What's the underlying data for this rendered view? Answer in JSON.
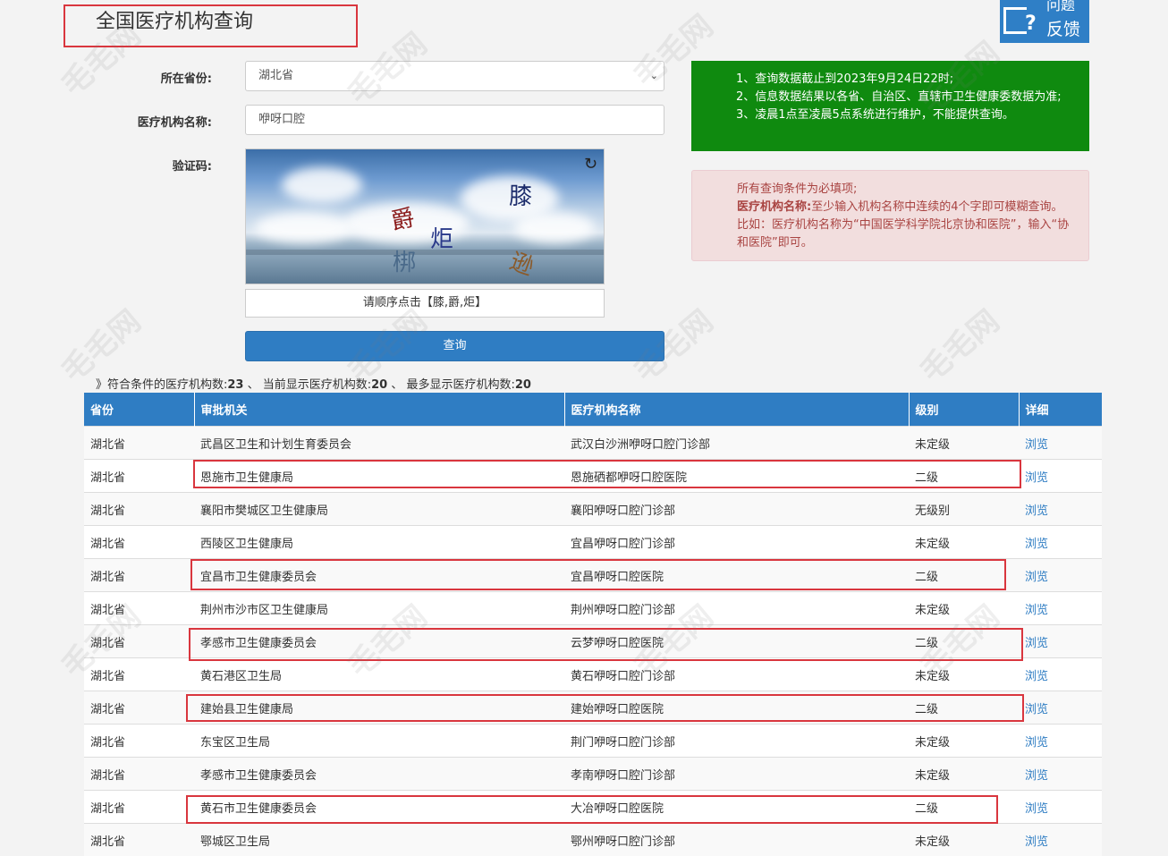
{
  "title": "全国医疗机构查询",
  "feedback": {
    "top": "问题",
    "label": "反馈"
  },
  "form": {
    "province_label": "所在省份:",
    "province_value": "湖北省",
    "name_label": "医疗机构名称:",
    "name_value": "咿呀口腔",
    "captcha_label": "验证码:",
    "captcha_chars": [
      "膝",
      "爵",
      "炬",
      "梆",
      "逊"
    ],
    "captcha_hint": "请顺序点击【膝,爵,炬】",
    "query_button": "查询"
  },
  "notice_green": [
    "1、查询数据截止到2023年9月24日22时;",
    "2、信息数据结果以各省、自治区、直辖市卫生健康委数据为准;",
    "3、凌晨1点至凌晨5点系统进行维护，不能提供查询。"
  ],
  "notice_red": {
    "line1": "所有查询条件为必填项;",
    "bold": "医疗机构名称:",
    "rest": "至少输入机构名称中连续的4个字即可模糊查询。比如：医疗机构名称为“中国医学科学院北京协和医院”，输入“协和医院”即可。"
  },
  "summary": {
    "prefix": "》符合条件的医疗机构数:",
    "total": "23",
    "sep1": "、 当前显示医疗机构数:",
    "shown": "20",
    "sep2": "、 最多显示医疗机构数:",
    "max": "20"
  },
  "table": {
    "headers": [
      "省份",
      "审批机关",
      "医疗机构名称",
      "级别",
      "详细"
    ],
    "rows": [
      [
        "湖北省",
        "武昌区卫生和计划生育委员会",
        "武汉白沙洲咿呀口腔门诊部",
        "未定级",
        "浏览"
      ],
      [
        "湖北省",
        "恩施市卫生健康局",
        "恩施硒都咿呀口腔医院",
        "二级",
        "浏览"
      ],
      [
        "湖北省",
        "襄阳市樊城区卫生健康局",
        "襄阳咿呀口腔门诊部",
        "无级别",
        "浏览"
      ],
      [
        "湖北省",
        "西陵区卫生健康局",
        "宜昌咿呀口腔门诊部",
        "未定级",
        "浏览"
      ],
      [
        "湖北省",
        "宜昌市卫生健康委员会",
        "宜昌咿呀口腔医院",
        "二级",
        "浏览"
      ],
      [
        "湖北省",
        "荆州市沙市区卫生健康局",
        "荆州咿呀口腔门诊部",
        "未定级",
        "浏览"
      ],
      [
        "湖北省",
        "孝感市卫生健康委员会",
        "云梦咿呀口腔医院",
        "二级",
        "浏览"
      ],
      [
        "湖北省",
        "黄石港区卫生局",
        "黄石咿呀口腔门诊部",
        "未定级",
        "浏览"
      ],
      [
        "湖北省",
        "建始县卫生健康局",
        "建始咿呀口腔医院",
        "二级",
        "浏览"
      ],
      [
        "湖北省",
        "东宝区卫生局",
        "荆门咿呀口腔门诊部",
        "未定级",
        "浏览"
      ],
      [
        "湖北省",
        "孝感市卫生健康委员会",
        "孝南咿呀口腔门诊部",
        "未定级",
        "浏览"
      ],
      [
        "湖北省",
        "黄石市卫生健康委员会",
        "大冶咿呀口腔医院",
        "二级",
        "浏览"
      ],
      [
        "湖北省",
        "鄂城区卫生局",
        "鄂州咿呀口腔门诊部",
        "未定级",
        "浏览"
      ]
    ]
  },
  "watermark": "毛毛网"
}
